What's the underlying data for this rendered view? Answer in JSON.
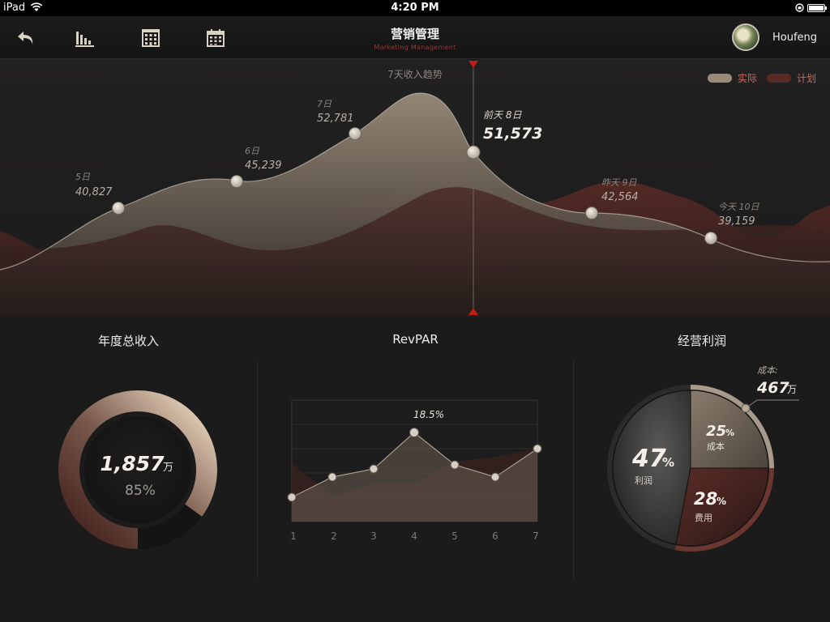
{
  "status_bar": {
    "device": "iPad",
    "time": "4:20 PM"
  },
  "nav": {
    "title": "营销管理",
    "subtitle": "Marketing Management",
    "username": "Houfeng",
    "icons": [
      "back-arrow-icon",
      "bar-chart-icon",
      "building-icon",
      "calendar-icon"
    ]
  },
  "trend": {
    "title": "7天收入趋势",
    "legend": {
      "actual": "实际",
      "plan": "计划"
    },
    "colors": {
      "actual": "#8a7b6b",
      "plan": "#5a2a25",
      "marker": "#c01d18"
    },
    "points": [
      {
        "date": "5日",
        "value": "40,827"
      },
      {
        "date": "6日",
        "value": "45,239"
      },
      {
        "date": "7日",
        "value": "52,781"
      },
      {
        "date": "前天 8日",
        "value": "51,573"
      },
      {
        "date": "昨天 9日",
        "value": "42,564"
      },
      {
        "date": "今天 10日",
        "value": "39,159"
      }
    ]
  },
  "annual_revenue": {
    "title": "年度总收入",
    "value": "1,857",
    "unit": "万",
    "percent": "85%",
    "progress": 0.85
  },
  "revpar": {
    "title": "RevPAR",
    "highlight_label": "18.5%",
    "x_labels": [
      "1",
      "2",
      "3",
      "4",
      "5",
      "6",
      "7"
    ]
  },
  "operating_profit": {
    "title": "经营利润",
    "cost_callout_label": "成本:",
    "cost_callout_value": "467",
    "cost_callout_unit": "万",
    "slices": [
      {
        "name": "利润",
        "value": "47",
        "pct": "%",
        "share": 0.47,
        "color": "#2b2b2b"
      },
      {
        "name": "成本",
        "value": "25",
        "pct": "%",
        "share": 0.25,
        "color": "#6e6255"
      },
      {
        "name": "费用",
        "value": "28",
        "pct": "%",
        "share": 0.28,
        "color": "#3e1f1c"
      }
    ]
  }
}
